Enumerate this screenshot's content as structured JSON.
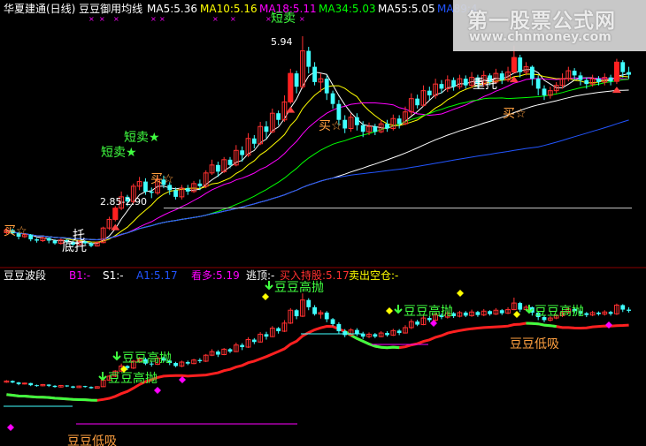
{
  "header": {
    "title": "华夏建通(日线) 豆豆御用均线",
    "ma": [
      {
        "label": "MA5:5.36",
        "color": "#ffffff"
      },
      {
        "label": "MA10:5.16",
        "color": "#ffff00"
      },
      {
        "label": "MA18:5.11",
        "color": "#ff00ff"
      },
      {
        "label": "MA34:5.03",
        "color": "#00ff00"
      },
      {
        "label": "MA55:5.05",
        "color": "#ffffff"
      },
      {
        "label": "MA89:4",
        "color": "#2255ff"
      }
    ]
  },
  "lower_header": {
    "title": "豆豆波段",
    "items": [
      {
        "label": "B1:-",
        "color": "#ff00ff"
      },
      {
        "label": "S1:-",
        "color": "#ffffff"
      },
      {
        "label": "A1:5.17",
        "color": "#2255ff"
      },
      {
        "label": "看多:5.19",
        "color": "#ff00ff"
      },
      {
        "label": "逃顶:-",
        "color": "#ffffff"
      },
      {
        "label": "买入持股:5.17",
        "color": "#ff3030"
      },
      {
        "label": "卖出空仓:-",
        "color": "#ffff00"
      }
    ]
  },
  "upper_annotations": [
    {
      "text": "5.94",
      "color": "#ffffff"
    },
    {
      "text": "短卖★",
      "color": "#40ff40"
    },
    {
      "text": "短卖★",
      "color": "#40ff40"
    },
    {
      "text": "买☆",
      "color": "#ffa040"
    },
    {
      "text": "买☆",
      "color": "#ffa040"
    },
    {
      "text": "买☆",
      "color": "#ffa040"
    },
    {
      "text": "买☆",
      "color": "#ffa040"
    },
    {
      "text": "2.85-2.90",
      "color": "#ffffff"
    },
    {
      "text": "底托",
      "color": "#ffffff"
    },
    {
      "text": "托",
      "color": "#ffffff"
    },
    {
      "text": "短卖",
      "color": "#40ff40"
    }
  ],
  "lower_annotations": [
    {
      "text": "豆豆高抛",
      "color": "#40ff40"
    },
    {
      "text": "豆豆高抛",
      "color": "#40ff40"
    },
    {
      "text": "豆豆高抛",
      "color": "#40ff40"
    },
    {
      "text": "豆豆高抛",
      "color": "#40ff40"
    },
    {
      "text": "豆豆低吸",
      "color": "#ffa040"
    },
    {
      "text": "豆豆低吸",
      "color": "#ffa040"
    },
    {
      "text": "豆豆高抛",
      "color": "#40ff40"
    }
  ],
  "watermark": {
    "line1": "第一股票公式网",
    "line2": "www.chnmoney.com"
  },
  "chart_data": {
    "type": "candlestick",
    "price_range": [
      2.6,
      6.3
    ],
    "support_line": 3.35,
    "candles": [
      [
        2.98,
        3.02,
        3.05,
        2.96
      ],
      [
        3.02,
        2.97,
        3.04,
        2.95
      ],
      [
        2.97,
        2.92,
        2.99,
        2.88
      ],
      [
        2.92,
        2.95,
        2.97,
        2.9
      ],
      [
        2.95,
        2.88,
        2.96,
        2.85
      ],
      [
        2.88,
        2.86,
        2.9,
        2.83
      ],
      [
        2.86,
        2.9,
        2.92,
        2.84
      ],
      [
        2.9,
        2.86,
        2.91,
        2.82
      ],
      [
        2.86,
        2.82,
        2.88,
        2.8
      ],
      [
        2.82,
        2.87,
        2.89,
        2.8
      ],
      [
        2.87,
        2.84,
        2.88,
        2.82
      ],
      [
        2.84,
        2.8,
        2.86,
        2.78
      ],
      [
        2.8,
        2.85,
        2.87,
        2.79
      ],
      [
        2.85,
        2.82,
        2.86,
        2.8
      ],
      [
        2.82,
        2.78,
        2.84,
        2.76
      ],
      [
        2.78,
        2.83,
        2.85,
        2.77
      ],
      [
        2.83,
        3.05,
        3.07,
        2.82
      ],
      [
        3.05,
        3.18,
        3.22,
        3.02
      ],
      [
        3.18,
        3.35,
        3.38,
        3.15
      ],
      [
        3.35,
        3.52,
        3.6,
        3.32
      ],
      [
        3.52,
        3.45,
        3.55,
        3.38
      ],
      [
        3.45,
        3.68,
        3.72,
        3.42
      ],
      [
        3.68,
        3.75,
        3.82,
        3.62
      ],
      [
        3.75,
        3.6,
        3.8,
        3.55
      ],
      [
        3.6,
        3.58,
        3.66,
        3.5
      ],
      [
        3.58,
        3.78,
        3.85,
        3.55
      ],
      [
        3.78,
        3.7,
        3.84,
        3.65
      ],
      [
        3.7,
        3.62,
        3.74,
        3.55
      ],
      [
        3.62,
        3.52,
        3.66,
        3.48
      ],
      [
        3.52,
        3.65,
        3.7,
        3.48
      ],
      [
        3.65,
        3.6,
        3.7,
        3.55
      ],
      [
        3.6,
        3.72,
        3.76,
        3.58
      ],
      [
        3.72,
        3.68,
        3.78,
        3.62
      ],
      [
        3.68,
        3.88,
        3.92,
        3.65
      ],
      [
        3.88,
        4.0,
        4.08,
        3.85
      ],
      [
        4.0,
        3.9,
        4.05,
        3.82
      ],
      [
        3.9,
        4.08,
        4.12,
        3.88
      ],
      [
        4.08,
        4.0,
        4.12,
        3.95
      ],
      [
        4.0,
        4.22,
        4.3,
        3.98
      ],
      [
        4.22,
        4.15,
        4.28,
        4.05
      ],
      [
        4.15,
        4.4,
        4.48,
        4.12
      ],
      [
        4.4,
        4.32,
        4.45,
        4.25
      ],
      [
        4.32,
        4.58,
        4.65,
        4.3
      ],
      [
        4.58,
        4.5,
        4.66,
        4.4
      ],
      [
        4.5,
        4.78,
        4.85,
        4.48
      ],
      [
        4.78,
        4.68,
        4.82,
        4.6
      ],
      [
        4.68,
        4.95,
        5.05,
        4.65
      ],
      [
        4.95,
        5.38,
        5.45,
        4.92
      ],
      [
        5.38,
        5.18,
        5.42,
        5.08
      ],
      [
        5.18,
        5.72,
        5.94,
        5.15
      ],
      [
        5.72,
        5.48,
        5.78,
        5.38
      ],
      [
        5.48,
        5.25,
        5.55,
        5.2
      ],
      [
        5.25,
        5.3,
        5.38,
        5.1
      ],
      [
        5.3,
        5.08,
        5.35,
        4.98
      ],
      [
        5.08,
        4.92,
        5.12,
        4.85
      ],
      [
        4.92,
        4.68,
        4.98,
        4.6
      ],
      [
        4.68,
        4.55,
        4.75,
        4.48
      ],
      [
        4.55,
        4.72,
        4.78,
        4.5
      ],
      [
        4.72,
        4.6,
        4.78,
        4.52
      ],
      [
        4.6,
        4.5,
        4.66,
        4.42
      ],
      [
        4.5,
        4.58,
        4.64,
        4.45
      ],
      [
        4.58,
        4.5,
        4.62,
        4.45
      ],
      [
        4.5,
        4.62,
        4.68,
        4.48
      ],
      [
        4.62,
        4.55,
        4.68,
        4.5
      ],
      [
        4.55,
        4.7,
        4.76,
        4.52
      ],
      [
        4.7,
        4.62,
        4.75,
        4.55
      ],
      [
        4.62,
        4.8,
        4.88,
        4.6
      ],
      [
        4.8,
        5.0,
        5.08,
        4.75
      ],
      [
        5.0,
        4.9,
        5.06,
        4.85
      ],
      [
        4.9,
        5.12,
        5.2,
        4.88
      ],
      [
        5.12,
        5.05,
        5.18,
        4.98
      ],
      [
        5.05,
        5.22,
        5.3,
        5.0
      ],
      [
        5.22,
        5.15,
        5.28,
        5.08
      ],
      [
        5.15,
        5.28,
        5.35,
        5.1
      ],
      [
        5.28,
        5.18,
        5.32,
        5.12
      ],
      [
        5.18,
        5.3,
        5.36,
        5.14
      ],
      [
        5.3,
        5.2,
        5.35,
        5.15
      ],
      [
        5.2,
        5.32,
        5.4,
        5.16
      ],
      [
        5.32,
        5.22,
        5.36,
        5.16
      ],
      [
        5.22,
        5.35,
        5.42,
        5.18
      ],
      [
        5.35,
        5.25,
        5.38,
        5.2
      ],
      [
        5.25,
        5.38,
        5.45,
        5.22
      ],
      [
        5.38,
        5.28,
        5.42,
        5.22
      ],
      [
        5.28,
        5.4,
        5.48,
        5.25
      ],
      [
        5.4,
        5.62,
        5.8,
        5.38
      ],
      [
        5.62,
        5.4,
        5.66,
        5.32
      ],
      [
        5.4,
        5.48,
        5.55,
        5.35
      ],
      [
        5.48,
        5.3,
        5.5,
        5.2
      ],
      [
        5.3,
        5.15,
        5.35,
        5.05
      ],
      [
        5.15,
        5.05,
        5.2,
        4.98
      ],
      [
        5.05,
        5.12,
        5.18,
        5.0
      ],
      [
        5.12,
        5.2,
        5.25,
        5.08
      ],
      [
        5.2,
        5.3,
        5.38,
        5.15
      ],
      [
        5.3,
        5.42,
        5.48,
        5.26
      ],
      [
        5.42,
        5.35,
        5.46,
        5.28
      ],
      [
        5.35,
        5.28,
        5.4,
        5.2
      ],
      [
        5.28,
        5.22,
        5.32,
        5.15
      ],
      [
        5.22,
        5.3,
        5.36,
        5.18
      ],
      [
        5.3,
        5.25,
        5.34,
        5.2
      ],
      [
        5.25,
        5.32,
        5.38,
        5.2
      ],
      [
        5.32,
        5.26,
        5.36,
        5.2
      ],
      [
        5.26,
        5.55,
        5.6,
        5.22
      ],
      [
        5.55,
        5.4,
        5.58,
        5.32
      ],
      [
        5.4,
        5.36,
        5.48,
        5.3
      ]
    ]
  }
}
